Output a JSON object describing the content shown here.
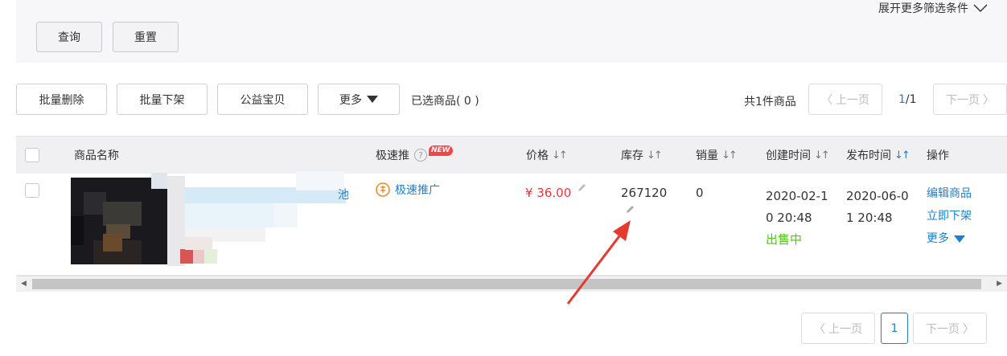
{
  "filter": {
    "query_label": "查询",
    "reset_label": "重置",
    "expand_label": "展开更多筛选条件"
  },
  "toolbar": {
    "batch_delete": "批量删除",
    "batch_delist": "批量下架",
    "charity": "公益宝贝",
    "more": "更多",
    "selected": "已选商品( 0 )",
    "total": "共1件商品",
    "prev": "上一页",
    "next": "下一页",
    "page_current": "1",
    "page_sep_total": "/1"
  },
  "table": {
    "headers": {
      "name": "商品名称",
      "promo": "极速推",
      "promo_badge": "NEW",
      "price": "价格",
      "stock": "库存",
      "sales": "销量",
      "created": "创建时间",
      "published": "发布时间",
      "actions": "操作"
    },
    "rows": [
      {
        "name_tail": "池",
        "promo_link": "极速推广",
        "price": "¥ 36.00",
        "stock": "267120",
        "sales": "0",
        "created_line1": "2020-02-1",
        "created_line2": "0 20:48",
        "status": "出售中",
        "published_line1": "2020-06-0",
        "published_line2": "1 20:48",
        "action_edit": "编辑商品",
        "action_delist": "立即下架",
        "action_more": "更多"
      }
    ]
  },
  "pagination": {
    "prev": "上一页",
    "current": "1",
    "next": "下一页"
  },
  "colors": {
    "accent": "#1c7fcf",
    "price": "#e4393c",
    "status": "#52c41a",
    "annotation_arrow": "#e8392f"
  }
}
